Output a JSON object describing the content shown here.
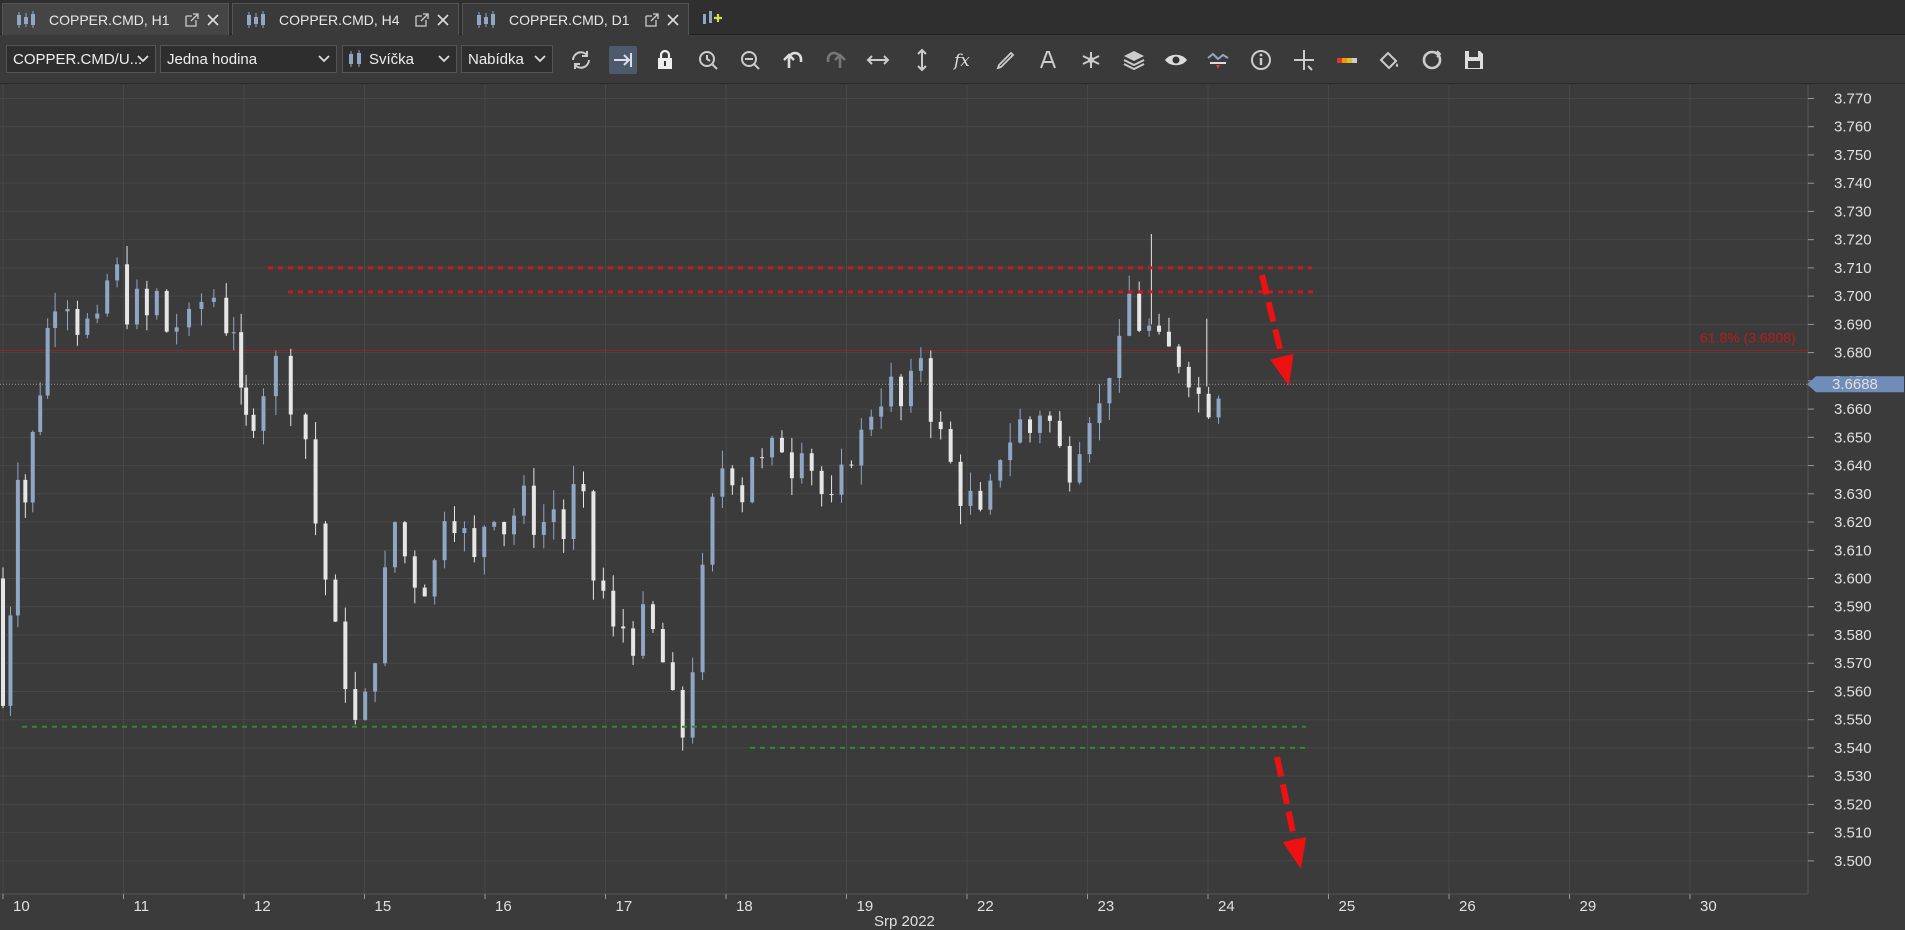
{
  "tabs": [
    {
      "label": "COPPER.CMD, H1",
      "active": true
    },
    {
      "label": "COPPER.CMD, H4",
      "active": false
    },
    {
      "label": "COPPER.CMD, D1",
      "active": false
    }
  ],
  "toolbar": {
    "instrument": "COPPER.CMD/U...",
    "period": "Jedna hodina",
    "chart_type": "Svíčka",
    "offer_side": "Nabídka",
    "icons": [
      "refresh-icon",
      "autoshift-icon",
      "lock-icon",
      "zoom-time-icon",
      "zoom-out-icon",
      "undo-icon",
      "redo-icon",
      "fit-horizontal-icon",
      "fit-vertical-icon",
      "indicator-fx-icon",
      "pencil-draw-icon",
      "text-tool-icon",
      "pattern-tool-icon",
      "layers-icon",
      "visibility-eye-icon",
      "alert-icon",
      "info-icon",
      "crosshair-icon",
      "theme-colors-icon",
      "fill-paint-icon",
      "loop-icon",
      "save-icon"
    ]
  },
  "colors": {
    "background": "#3b3b3b",
    "grid": "#474747",
    "bull": "#8fa6c5",
    "bear": "#e6e6e6",
    "resistance": "#cc1a1a",
    "support": "#2e8b2e",
    "fib": "#b81c1c",
    "arrow": "#ee1111",
    "price_badge": "#6f8db8"
  },
  "chart_data": {
    "type": "candlestick",
    "symbol": "COPPER.CMD",
    "timeframe": "H1",
    "ylim": [
      3.495,
      3.773
    ],
    "y_ticks": [
      "3.770",
      "3.760",
      "3.750",
      "3.740",
      "3.730",
      "3.720",
      "3.710",
      "3.700",
      "3.690",
      "3.680",
      "3.670",
      "3.660",
      "3.650",
      "3.640",
      "3.630",
      "3.620",
      "3.610",
      "3.600",
      "3.590",
      "3.580",
      "3.570",
      "3.560",
      "3.550",
      "3.540",
      "3.530",
      "3.520",
      "3.510",
      "3.500"
    ],
    "x_ticks": [
      "10",
      "11",
      "12",
      "15",
      "16",
      "17",
      "18",
      "19",
      "22",
      "23",
      "24",
      "25",
      "26",
      "29",
      "30"
    ],
    "x_axis_title": "Srp 2022",
    "current_price": "3.6688",
    "fib_label": "61.8% (3.6808)",
    "fib_level": 3.6808,
    "resistance_levels": [
      3.71,
      3.7015
    ],
    "support_levels": [
      3.5475,
      3.54
    ],
    "close_path": [
      [
        10.0,
        3.6
      ],
      [
        10.3,
        3.555
      ],
      [
        10.6,
        3.59
      ],
      [
        10.9,
        3.64
      ],
      [
        11.2,
        3.628
      ],
      [
        11.5,
        3.65
      ],
      [
        11.8,
        3.668
      ],
      [
        12.1,
        3.688
      ],
      [
        12.6,
        3.7
      ],
      [
        13.0,
        3.7
      ],
      [
        13.4,
        3.69
      ],
      [
        13.8,
        3.69
      ],
      [
        14.2,
        3.688
      ],
      [
        14.6,
        3.705
      ],
      [
        15.0,
        3.708
      ],
      [
        15.4,
        3.695
      ],
      [
        15.8,
        3.698
      ],
      [
        16.2,
        3.692
      ],
      [
        16.6,
        3.7
      ],
      [
        17.0,
        3.688
      ],
      [
        17.5,
        3.69
      ],
      [
        18.0,
        3.69
      ],
      [
        18.5,
        3.698
      ],
      [
        19.0,
        3.7
      ],
      [
        19.3,
        3.69
      ],
      [
        19.6,
        3.69
      ],
      [
        19.8,
        3.662
      ],
      [
        20.1,
        3.655
      ],
      [
        20.5,
        3.658
      ],
      [
        21.0,
        3.668
      ],
      [
        21.6,
        3.676
      ],
      [
        22.2,
        3.664
      ],
      [
        22.6,
        3.65
      ],
      [
        23.0,
        3.62
      ],
      [
        23.4,
        3.6
      ],
      [
        23.8,
        3.58
      ],
      [
        24.2,
        3.565
      ],
      [
        24.6,
        3.548
      ],
      [
        25.0,
        3.556
      ],
      [
        25.4,
        3.575
      ],
      [
        25.8,
        3.6
      ],
      [
        26.2,
        3.62
      ],
      [
        26.6,
        3.608
      ],
      [
        27.0,
        3.6
      ],
      [
        27.4,
        3.598
      ],
      [
        27.8,
        3.605
      ],
      [
        28.2,
        3.625
      ],
      [
        28.6,
        3.622
      ],
      [
        29.0,
        3.615
      ],
      [
        29.4,
        3.605
      ],
      [
        29.8,
        3.62
      ],
      [
        30.2,
        3.625
      ],
      [
        30.6,
        3.618
      ],
      [
        31.0,
        3.623
      ],
      [
        31.4,
        3.628
      ],
      [
        31.8,
        3.62
      ],
      [
        32.2,
        3.62
      ],
      [
        32.6,
        3.625
      ],
      [
        33.0,
        3.615
      ],
      [
        33.4,
        3.63
      ],
      [
        33.8,
        3.625
      ],
      [
        34.2,
        3.6
      ],
      [
        34.6,
        3.595
      ],
      [
        35.0,
        3.58
      ],
      [
        35.4,
        3.583
      ],
      [
        35.8,
        3.578
      ],
      [
        36.2,
        3.585
      ],
      [
        36.6,
        3.58
      ],
      [
        37.0,
        3.57
      ],
      [
        37.4,
        3.555
      ],
      [
        37.8,
        3.545
      ],
      [
        38.2,
        3.57
      ],
      [
        38.6,
        3.6
      ],
      [
        39.0,
        3.625
      ],
      [
        39.4,
        3.64
      ],
      [
        39.8,
        3.638
      ],
      [
        40.2,
        3.63
      ],
      [
        40.6,
        3.645
      ],
      [
        41.0,
        3.64
      ],
      [
        41.4,
        3.645
      ],
      [
        41.8,
        3.648
      ],
      [
        42.2,
        3.64
      ],
      [
        42.6,
        3.65
      ],
      [
        43.0,
        3.64
      ],
      [
        43.4,
        3.63
      ],
      [
        43.8,
        3.625
      ],
      [
        44.2,
        3.635
      ],
      [
        44.6,
        3.645
      ],
      [
        45.0,
        3.65
      ],
      [
        45.4,
        3.66
      ],
      [
        45.8,
        3.665
      ],
      [
        46.2,
        3.668
      ],
      [
        46.6,
        3.66
      ],
      [
        47.0,
        3.668
      ],
      [
        47.4,
        3.68
      ],
      [
        47.8,
        3.66
      ],
      [
        48.2,
        3.65
      ],
      [
        48.6,
        3.64
      ],
      [
        49.0,
        3.63
      ],
      [
        49.4,
        3.628
      ],
      [
        49.8,
        3.62
      ],
      [
        50.2,
        3.63
      ],
      [
        50.6,
        3.645
      ],
      [
        51.0,
        3.65
      ],
      [
        51.4,
        3.655
      ],
      [
        51.8,
        3.652
      ],
      [
        52.2,
        3.66
      ],
      [
        52.6,
        3.655
      ],
      [
        53.0,
        3.645
      ],
      [
        53.4,
        3.64
      ],
      [
        53.8,
        3.65
      ],
      [
        54.2,
        3.66
      ],
      [
        54.6,
        3.66
      ],
      [
        55.0,
        3.675
      ],
      [
        55.4,
        3.68
      ],
      [
        55.8,
        3.7
      ],
      [
        56.2,
        3.69
      ],
      [
        56.6,
        3.688
      ],
      [
        57.0,
        3.682
      ],
      [
        57.4,
        3.68
      ],
      [
        57.8,
        3.678
      ],
      [
        58.2,
        3.673
      ],
      [
        58.6,
        3.665
      ],
      [
        59.0,
        3.662
      ],
      [
        59.4,
        3.668
      ]
    ]
  }
}
